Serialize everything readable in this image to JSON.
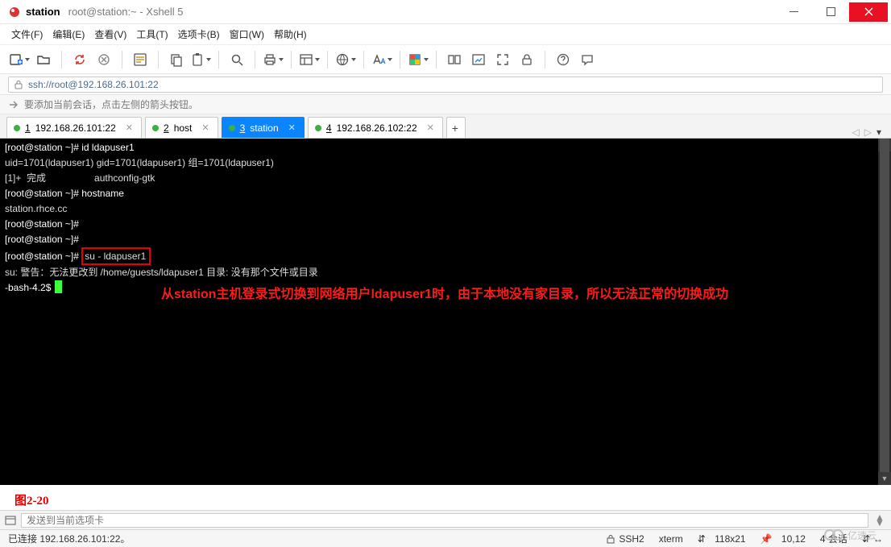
{
  "title": {
    "bold": "station",
    "rest": "root@station:~ - Xshell 5"
  },
  "menus": [
    "文件(F)",
    "编辑(E)",
    "查看(V)",
    "工具(T)",
    "选项卡(B)",
    "窗口(W)",
    "帮助(H)"
  ],
  "address": "ssh://root@192.168.26.101:22",
  "hint": "要添加当前会话，点击左侧的箭头按钮。",
  "tabs": [
    {
      "num": "1",
      "label": "192.168.26.101:22",
      "active": false
    },
    {
      "num": "2",
      "label": "host",
      "active": false
    },
    {
      "num": "3",
      "label": "station",
      "active": true
    },
    {
      "num": "4",
      "label": "192.168.26.102:22",
      "active": false
    }
  ],
  "terminal": {
    "lines": [
      {
        "prompt": "[root@station ~]#",
        "cmd": " id ldapuser1"
      },
      {
        "plain": "uid=1701(ldapuser1) gid=1701(ldapuser1) 组=1701(ldapuser1)"
      },
      {
        "plain": "[1]+  完成                  authconfig-gtk"
      },
      {
        "prompt": "[root@station ~]#",
        "cmd": " hostname"
      },
      {
        "plain": "station.rhce.cc"
      },
      {
        "prompt": "[root@station ~]#",
        "cmd": ""
      },
      {
        "prompt": "[root@station ~]#",
        "cmd": ""
      },
      {
        "prompt": "[root@station ~]#",
        "hlcmd": "su - ldapuser1"
      },
      {
        "plain": "su: 警告：无法更改到 /home/guests/ldapuser1 目录: 没有那个文件或目录"
      },
      {
        "bash": "-bash-4.2$ ",
        "cursor": true
      }
    ],
    "annotation": "从station主机登录式切换到网络用户ldapuser1时，由于本地没有家目录，所以无法正常的切换成功"
  },
  "figure": "图2-20",
  "sendPlaceholder": "发送到当前选项卡",
  "status": {
    "left": "已连接 192.168.26.101:22。",
    "ssh": "SSH2",
    "term": "xterm",
    "size": "118x21",
    "pos": "10,12",
    "sess": "4 会话"
  },
  "glyphs": {
    "updown": "⇵",
    "pin": "📌",
    "double": "↔"
  }
}
